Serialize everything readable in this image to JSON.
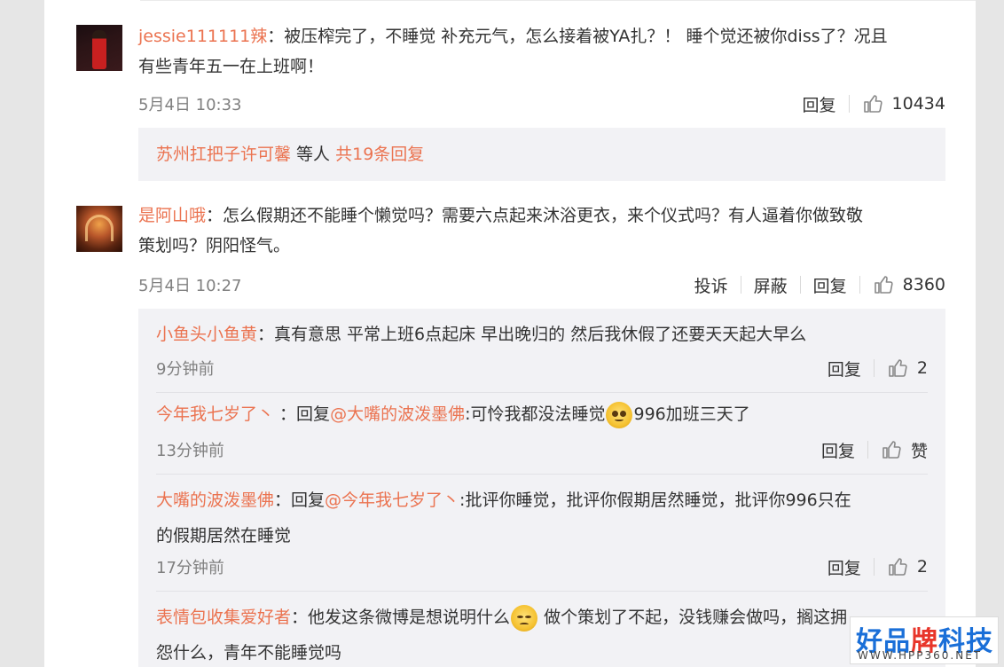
{
  "comments": [
    {
      "author": "jessie111111辣",
      "text_line1": "：被压榨完了，不睡觉 补充元气，怎么接着被YA扎？！ 睡个觉还被你diss了？况且",
      "text_line2": "有些青年五一在上班啊！",
      "time": "5月4日 10:33",
      "reply_label": "回复",
      "likes": "10434",
      "reply_summary": {
        "name": "苏州扛把子许可馨",
        "middle": " 等人 ",
        "count_link": "共19条回复"
      }
    },
    {
      "author": "是阿山哦",
      "text_line1": "：怎么假期还不能睡个懒觉吗？需要六点起来沐浴更衣，来个仪式吗？有人逼着你做致敬",
      "text_line2": "策划吗？阴阳怪气。",
      "time": "5月4日 10:27",
      "report_label": "投诉",
      "block_label": "屏蔽",
      "reply_label": "回复",
      "likes": "8360",
      "replies": [
        {
          "author": "小鱼头小鱼黄",
          "text": "：真有意思 平常上班6点起床 早出晚归的 然后我休假了还要天天起大早么",
          "time": "9分钟前",
          "reply_label": "回复",
          "likes": "2"
        },
        {
          "author": "今年我七岁了丶",
          "text_a": " ：回复",
          "mention": "@大嘴的波泼墨佛",
          "text_b": ":可怜我都没法睡觉",
          "emoji": "sad-emoji",
          "text_c": "996加班三天了",
          "time": "13分钟前",
          "reply_label": "回复",
          "likes": "赞"
        },
        {
          "author": "大嘴的波泼墨佛",
          "text_a": "：回复",
          "mention": "@今年我七岁了丶",
          "text_b": ":批评你睡觉，批评你假期居然睡觉，批评你996只在",
          "text_line2": "的假期居然在睡觉",
          "time": "17分钟前",
          "reply_label": "回复",
          "likes": "2"
        },
        {
          "author": "表情包收集爱好者",
          "text_a": "：他发这条微博是想说明什么",
          "emoji": "smirk-emoji",
          "text_b": " 做个策划了不起，没钱赚会做吗，搁这拥",
          "text_line2": "怨什么，青年不能睡觉吗"
        }
      ]
    }
  ],
  "watermark": {
    "title_a": "好品",
    "title_b": "牌",
    "title_c": "科技网",
    "url": "WWW.HPP360.NET"
  },
  "colors": {
    "username": "#eb7350",
    "reply_bg": "#f2f2f5",
    "page_bg": "#e6e6e6"
  }
}
